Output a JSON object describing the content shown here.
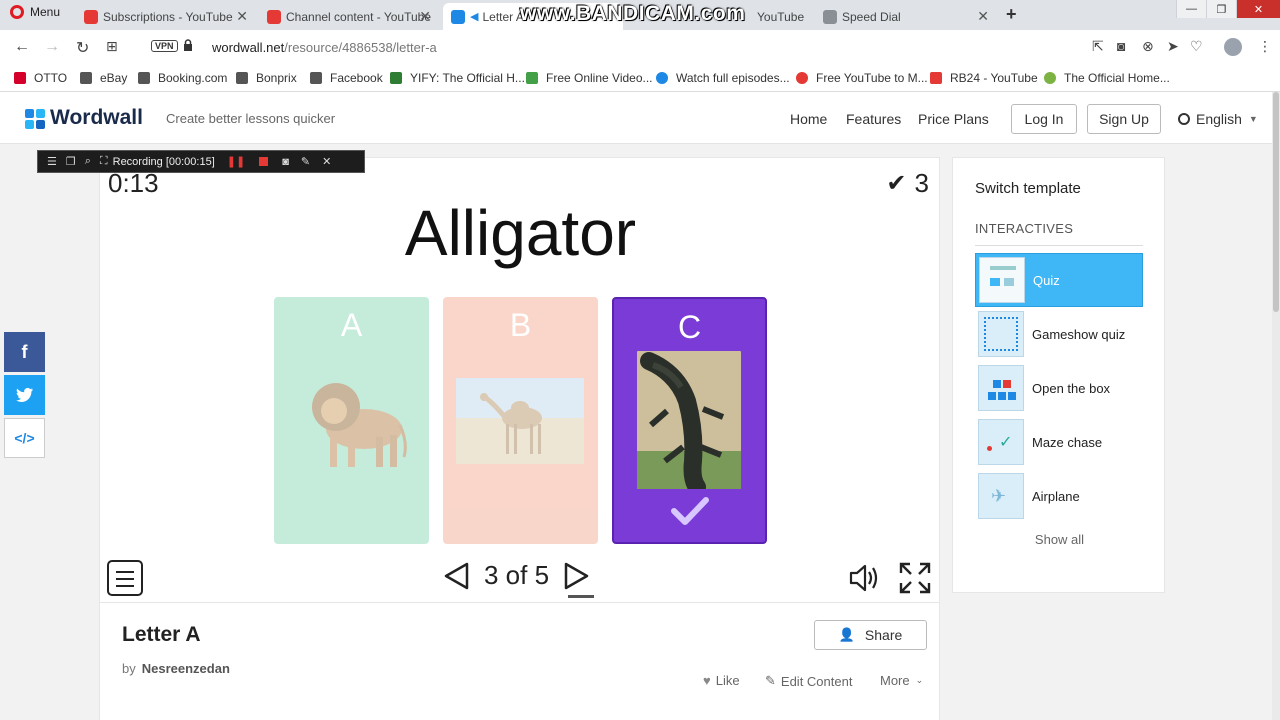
{
  "browser": {
    "menu_label": "Menu",
    "tabs": [
      {
        "title": "Subscriptions - YouTube",
        "active": false
      },
      {
        "title": "Channel content - YouTube",
        "active": false
      },
      {
        "title": "Letter A",
        "active": true
      },
      {
        "title": "YouTube",
        "active": false
      },
      {
        "title": "Speed Dial",
        "active": false
      }
    ],
    "url_host": "wordwall.net",
    "url_path": "/resource/4886538/letter-a",
    "vpn_label": "VPN",
    "watermark": "www.BANDICAM.com",
    "bookmarks": [
      {
        "label": "OTTO",
        "color": "#d4002b"
      },
      {
        "label": "eBay",
        "color": "#444444"
      },
      {
        "label": "Booking.com",
        "color": "#444444"
      },
      {
        "label": "Bonprix",
        "color": "#444444"
      },
      {
        "label": "Facebook",
        "color": "#444444"
      },
      {
        "label": "YIFY: The Official H...",
        "color": "#2e7d32"
      },
      {
        "label": "Free Online Video...",
        "color": "#43a047"
      },
      {
        "label": "Watch full episodes...",
        "color": "#1e88e5"
      },
      {
        "label": "Free YouTube to M...",
        "color": "#e53935"
      },
      {
        "label": "RB24 - YouTube",
        "color": "#e53935"
      },
      {
        "label": "The Official Home...",
        "color": "#7cb342"
      }
    ]
  },
  "site": {
    "logo": "Wordwall",
    "tagline": "Create better lessons quicker",
    "nav": [
      "Home",
      "Features",
      "Price Plans"
    ],
    "login": "Log In",
    "signup": "Sign Up",
    "language": "English"
  },
  "recorder": {
    "label": "Recording [00:00:15]"
  },
  "game": {
    "timer": "0:13",
    "score": "3",
    "question": "Alligator",
    "options": [
      {
        "letter": "A",
        "image": "lion",
        "color": "#7fd4b0",
        "state": "faded"
      },
      {
        "letter": "B",
        "image": "camel",
        "color": "#f2a58a",
        "state": "faded"
      },
      {
        "letter": "C",
        "image": "alligator",
        "color": "#7a3bd6",
        "state": "correct"
      }
    ],
    "page": "3 of 5",
    "colors": {
      "accent": "#3fb7f7",
      "correct": "#7a3bd6"
    }
  },
  "activity": {
    "title": "Letter A",
    "by_label": "by",
    "author": "Nesreenzedan",
    "share": "Share",
    "like": "Like",
    "edit": "Edit Content",
    "more": "More"
  },
  "sidebar": {
    "title": "Switch template",
    "section": "INTERACTIVES",
    "templates": [
      {
        "name": "Quiz",
        "selected": true
      },
      {
        "name": "Gameshow quiz",
        "selected": false
      },
      {
        "name": "Open the box",
        "selected": false
      },
      {
        "name": "Maze chase",
        "selected": false
      },
      {
        "name": "Airplane",
        "selected": false
      }
    ],
    "show_all": "Show all"
  }
}
